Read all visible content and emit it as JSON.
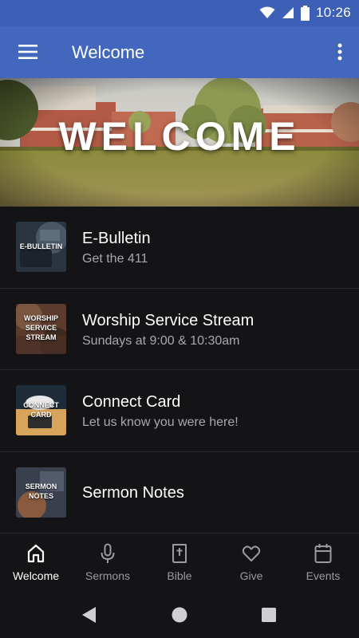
{
  "status_bar": {
    "time": "10:26",
    "icons": [
      "wifi-icon",
      "signal-icon",
      "battery-icon"
    ]
  },
  "app_bar": {
    "title": "Welcome",
    "menu_icon": "hamburger-menu-icon",
    "more_icon": "more-vert-icon"
  },
  "hero": {
    "title": "WELCOME"
  },
  "list": {
    "items": [
      {
        "title": "E-Bulletin",
        "subtitle": "Get the 411",
        "thumb_text": "E-BULLETIN"
      },
      {
        "title": "Worship Service Stream",
        "subtitle": "Sundays at 9:00 & 10:30am",
        "thumb_text": "WORSHIP SERVICE STREAM"
      },
      {
        "title": "Connect Card",
        "subtitle": "Let us know you were here!",
        "thumb_text": "CONNECT CARD"
      },
      {
        "title": "Sermon Notes",
        "subtitle": "",
        "thumb_text": "SERMON NOTES"
      }
    ]
  },
  "bottom_nav": {
    "items": [
      {
        "label": "Welcome",
        "icon": "home-icon",
        "active": true
      },
      {
        "label": "Sermons",
        "icon": "microphone-icon",
        "active": false
      },
      {
        "label": "Bible",
        "icon": "bible-icon",
        "active": false
      },
      {
        "label": "Give",
        "icon": "heart-icon",
        "active": false
      },
      {
        "label": "Events",
        "icon": "calendar-icon",
        "active": false
      }
    ]
  },
  "colors": {
    "status_bar": "#3d5fb5",
    "app_bar": "#4267bd",
    "background": "#141416",
    "subtitle": "#a8a8ae",
    "inactive_nav": "#9a9aa0"
  }
}
